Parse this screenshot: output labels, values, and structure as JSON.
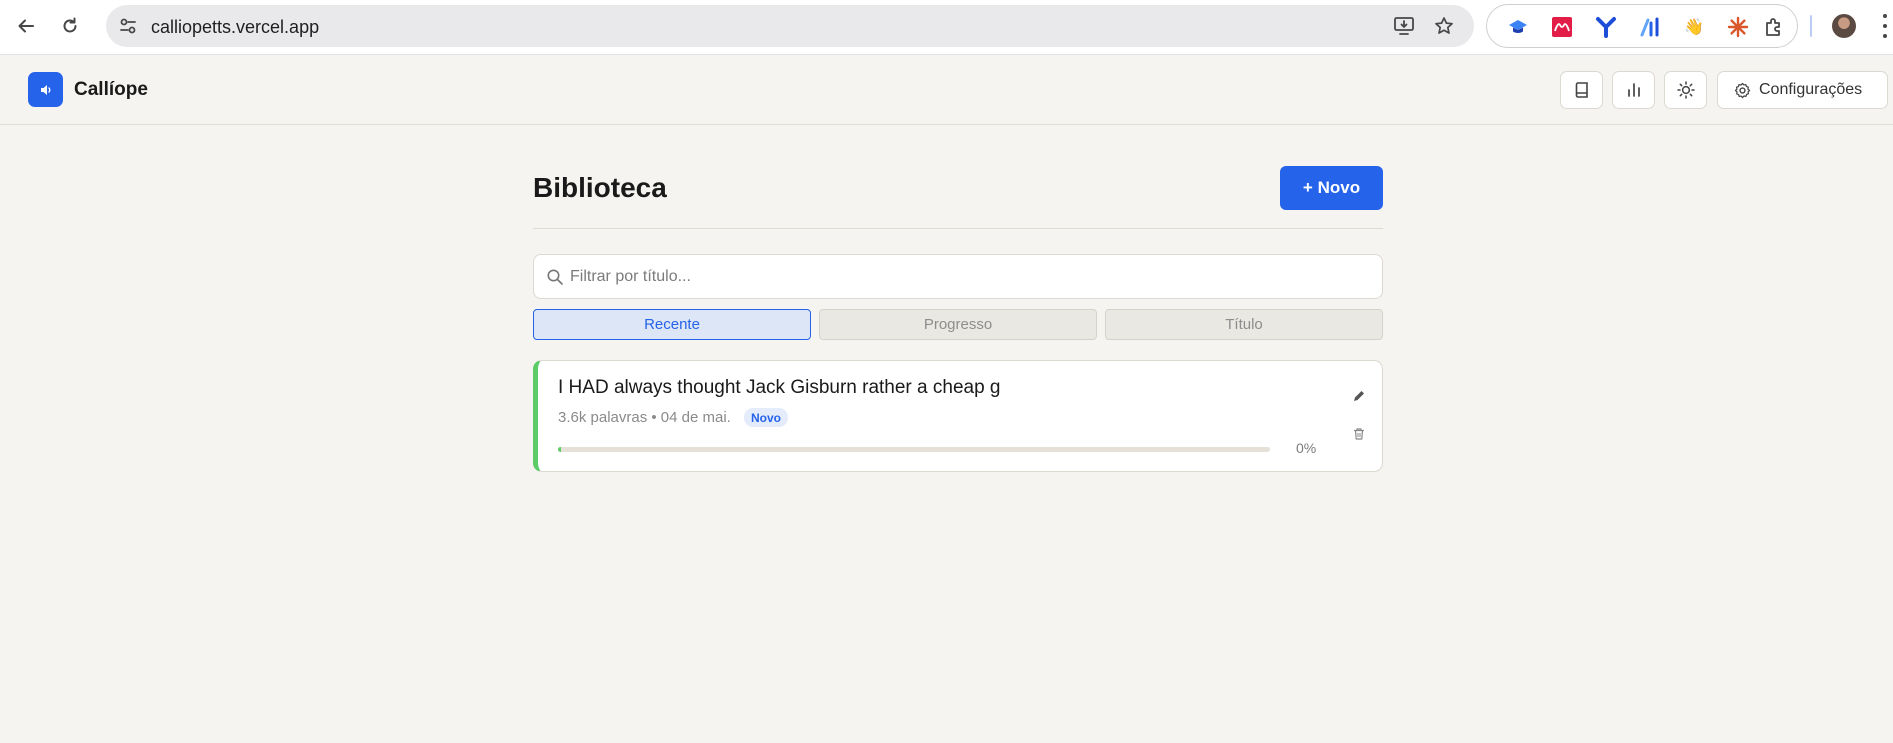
{
  "browser": {
    "url": "calliopetts.vercel.app",
    "icons": {
      "back": "arrow-left-icon",
      "reload": "reload-icon",
      "site_info": "tune-icon",
      "install": "install-app-icon",
      "bookmark": "star-icon",
      "extensions_menu": "puzzle-icon",
      "menu": "kebab-menu-icon"
    },
    "extensions": [
      {
        "name": "graduation-cap-extension-icon",
        "color": "#3b82f6"
      },
      {
        "name": "mendeley-extension-icon",
        "color": "#e11d48"
      },
      {
        "name": "y-extension-icon",
        "color": "#1d4ed8"
      },
      {
        "name": "chart-extension-icon",
        "color": "#2563eb"
      },
      {
        "name": "wave-hand-extension-icon",
        "glyph": "👋"
      },
      {
        "name": "asterisk-extension-icon",
        "color": "#d9572b"
      }
    ]
  },
  "header": {
    "brand": "Callíope",
    "settings_label": "Configurações",
    "accent": "#2563eb",
    "icons": [
      "book-icon",
      "bar-chart-icon",
      "sun-icon",
      "gear-icon"
    ]
  },
  "library": {
    "title": "Biblioteca",
    "new_button": "+ Novo",
    "search_placeholder": "Filtrar por título...",
    "search_value": "",
    "sort_tabs": [
      {
        "label": "Recente",
        "active": true
      },
      {
        "label": "Progresso",
        "active": false
      },
      {
        "label": "Título",
        "active": false
      }
    ],
    "items": [
      {
        "title": "I HAD always thought Jack Gisburn rather a cheap g",
        "meta": "3.6k palavras • 04 de mai.",
        "badge": "Novo",
        "progress": 0,
        "progress_label": "0%",
        "status_color": "#5ccc68"
      }
    ]
  }
}
